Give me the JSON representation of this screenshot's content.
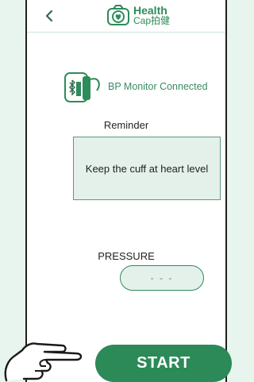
{
  "header": {
    "back_icon": "chevron-left-icon",
    "logo_title": "Health",
    "logo_subtitle": "Cap拍健"
  },
  "device": {
    "icon": "bp-monitor-icon",
    "status": "BP Monitor Connected"
  },
  "reminder": {
    "title": "Reminder",
    "message": "Keep the cuff at heart level"
  },
  "pressure": {
    "label": "PRESSURE",
    "value": "- - -"
  },
  "start": {
    "label": "START"
  },
  "colors": {
    "accent": "#2b8a57",
    "panel": "#e4f1eb",
    "background": "#e8f4ee"
  }
}
